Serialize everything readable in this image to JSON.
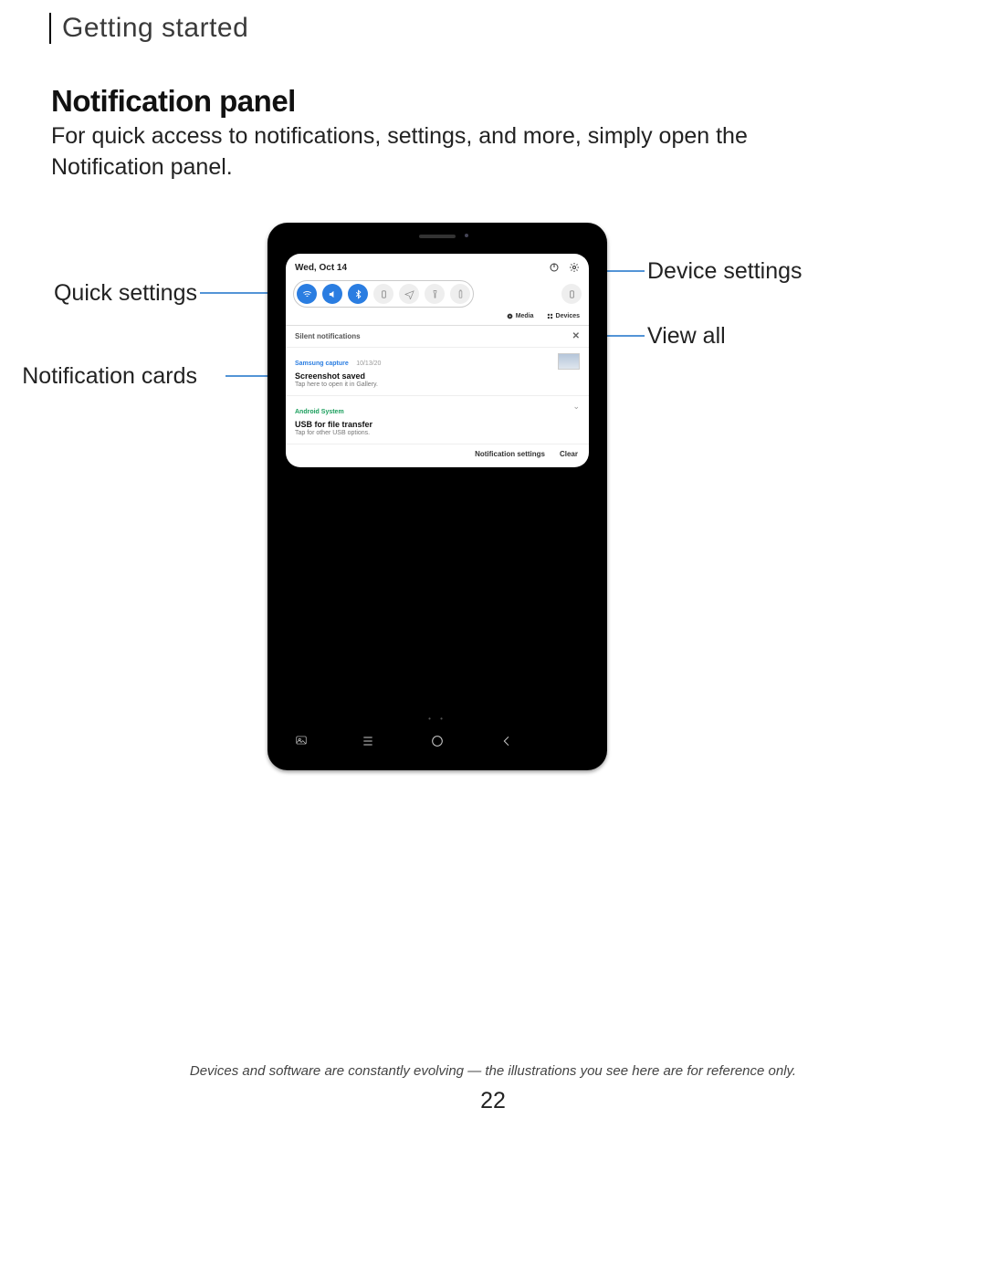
{
  "section": "Getting started",
  "heading": "Notification panel",
  "body": "For quick access to notifications, settings, and more, simply open the Notification panel.",
  "callouts": {
    "quick_settings": "Quick settings",
    "notification_cards": "Notification cards",
    "device_settings": "Device settings",
    "view_all": "View all"
  },
  "panel": {
    "date": "Wed, Oct 14",
    "sub_media": "Media",
    "sub_devices": "Devices",
    "silent_header": "Silent notifications",
    "cards": [
      {
        "app": "Samsung capture",
        "date": "10/13/20",
        "title": "Screenshot saved",
        "sub": "Tap here to open it in Gallery.",
        "thumb": true
      },
      {
        "app": "Android System",
        "date": "",
        "title": "USB for file transfer",
        "sub": "Tap for other USB options.",
        "thumb": false,
        "chevron": true
      }
    ],
    "footer_settings": "Notification settings",
    "footer_clear": "Clear"
  },
  "disclaimer": "Devices and software are constantly evolving — the illustrations you see here are for reference only.",
  "page_number": "22"
}
